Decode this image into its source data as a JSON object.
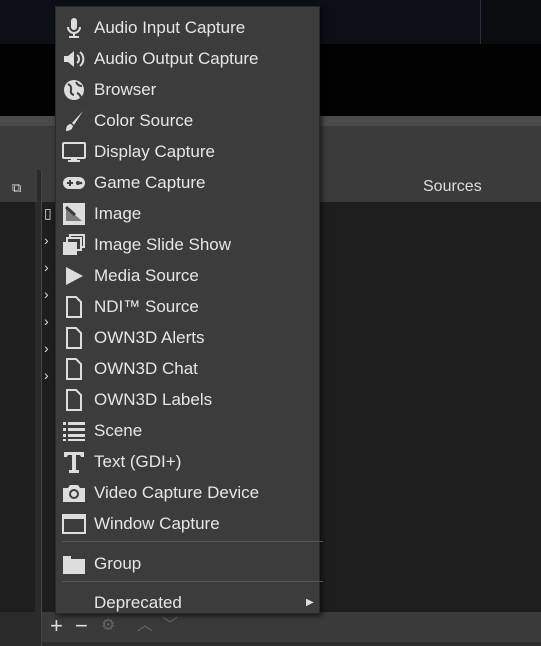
{
  "dock": {
    "title": "Sources"
  },
  "menu": {
    "items": [
      {
        "label": "Audio Input Capture",
        "icon": "microphone-icon"
      },
      {
        "label": "Audio Output Capture",
        "icon": "speaker-icon"
      },
      {
        "label": "Browser",
        "icon": "globe-icon"
      },
      {
        "label": "Color Source",
        "icon": "brush-icon"
      },
      {
        "label": "Display Capture",
        "icon": "monitor-icon"
      },
      {
        "label": "Game Capture",
        "icon": "gamepad-icon"
      },
      {
        "label": "Image",
        "icon": "image-icon"
      },
      {
        "label": "Image Slide Show",
        "icon": "slideshow-icon"
      },
      {
        "label": "Media Source",
        "icon": "play-icon"
      },
      {
        "label": "NDI™ Source",
        "icon": "file-icon"
      },
      {
        "label": "OWN3D Alerts",
        "icon": "file-icon"
      },
      {
        "label": "OWN3D Chat",
        "icon": "file-icon"
      },
      {
        "label": "OWN3D Labels",
        "icon": "file-icon"
      },
      {
        "label": "Scene",
        "icon": "list-icon"
      },
      {
        "label": "Text (GDI+)",
        "icon": "text-icon"
      },
      {
        "label": "Video Capture Device",
        "icon": "camera-icon"
      },
      {
        "label": "Window Capture",
        "icon": "window-icon"
      }
    ],
    "group": {
      "label": "Group",
      "icon": "folder-icon"
    },
    "deprecated": {
      "label": "Deprecated",
      "icon": "submenu-arrow-icon"
    }
  }
}
